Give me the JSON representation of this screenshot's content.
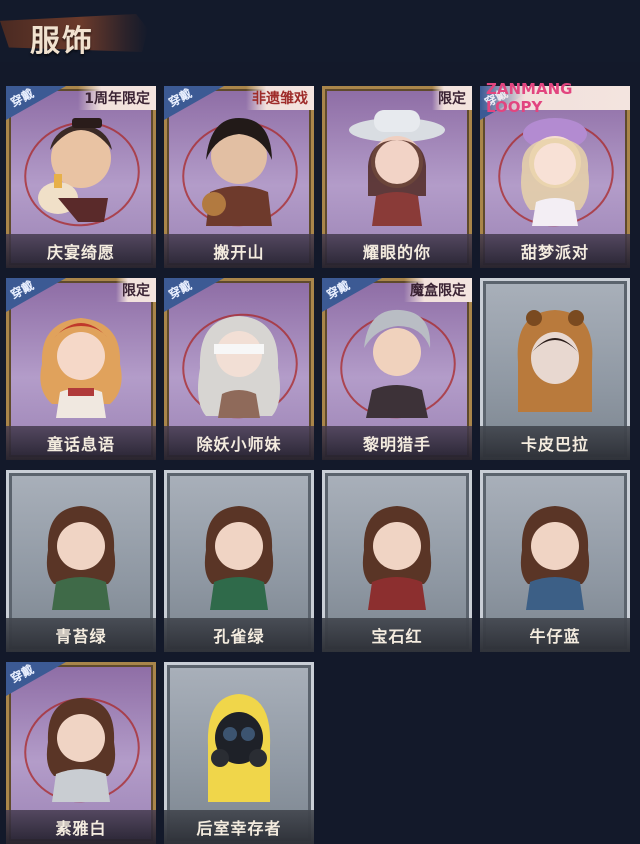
{
  "header": {
    "title": "服饰"
  },
  "worn_label": "穿戴",
  "cards": [
    {
      "name": "庆宴绮愿",
      "worn": true,
      "tag": "1周年限定",
      "style": "gold"
    },
    {
      "name": "搬开山",
      "worn": true,
      "tag": "非遗雏戏",
      "style": "gold"
    },
    {
      "name": "耀眼的你",
      "worn": false,
      "tag": "限定",
      "style": "gold"
    },
    {
      "name": "甜梦派对",
      "worn": true,
      "tag": "ZANMANG LOOPY",
      "style": "gold"
    },
    {
      "name": "童话息语",
      "worn": true,
      "tag": "限定",
      "style": "gold"
    },
    {
      "name": "除妖小师妹",
      "worn": true,
      "tag": "",
      "style": "gold"
    },
    {
      "name": "黎明猎手",
      "worn": true,
      "tag": "魔盒限定",
      "style": "gold"
    },
    {
      "name": "卡皮巴拉",
      "worn": false,
      "tag": "",
      "style": "gray"
    },
    {
      "name": "青苔绿",
      "worn": false,
      "tag": "",
      "style": "gray"
    },
    {
      "name": "孔雀绿",
      "worn": false,
      "tag": "",
      "style": "gray"
    },
    {
      "name": "宝石红",
      "worn": false,
      "tag": "",
      "style": "gray"
    },
    {
      "name": "牛仔蓝",
      "worn": false,
      "tag": "",
      "style": "gray"
    },
    {
      "name": "素雅白",
      "worn": true,
      "tag": "",
      "style": "gold"
    },
    {
      "name": "后室幸存者",
      "worn": false,
      "tag": "",
      "style": "gray"
    }
  ],
  "colors": {
    "gold_frame": "#a9854a",
    "gray_frame": "#c9ced6",
    "worn_badge": "#3c5a94",
    "background": "#13192a"
  }
}
